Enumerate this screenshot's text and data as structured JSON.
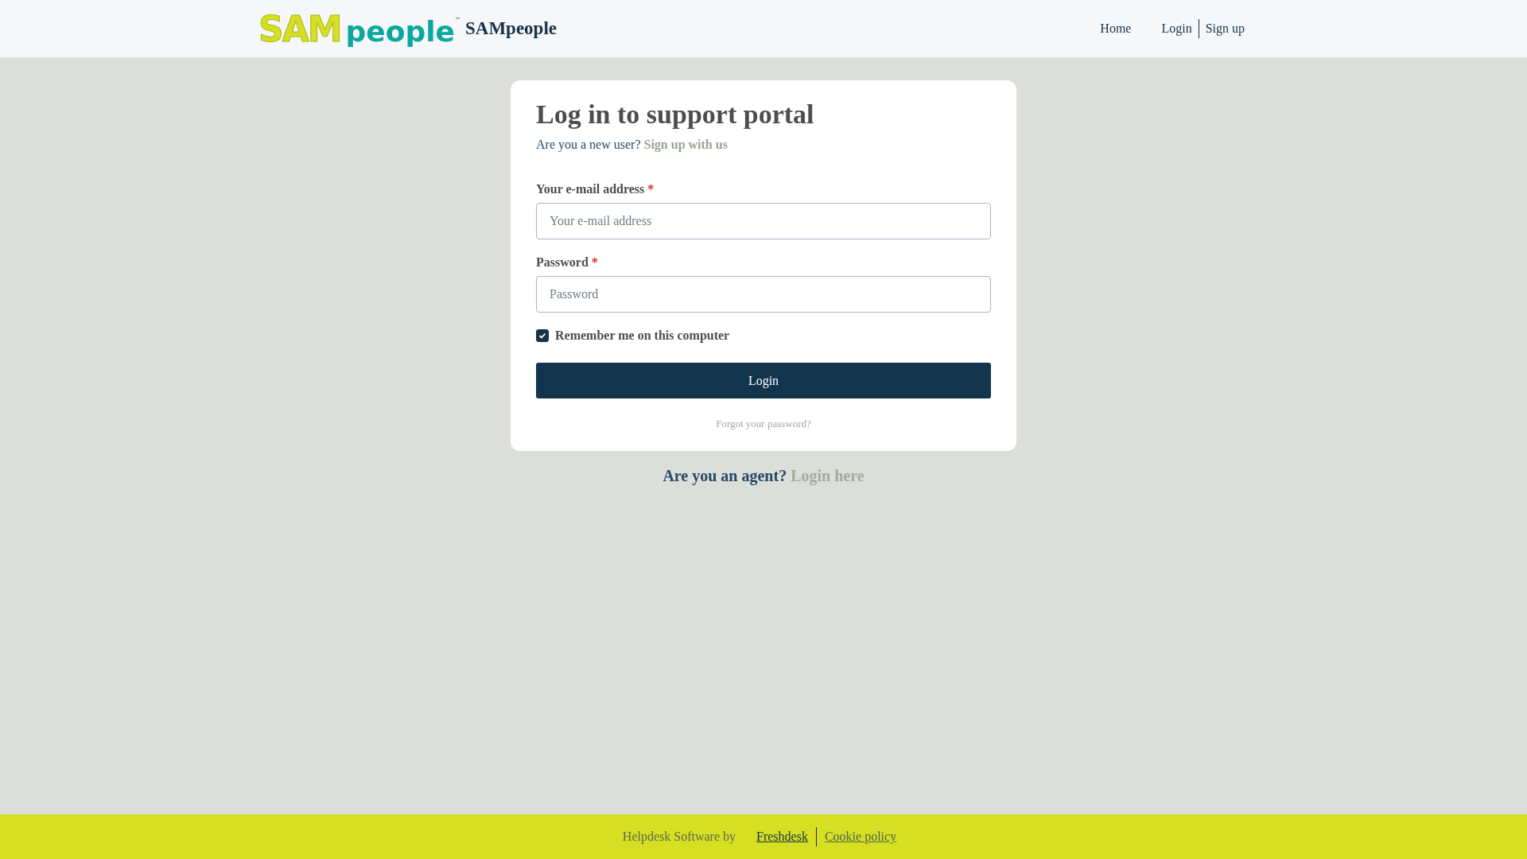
{
  "header": {
    "logo": {
      "part_1": "SAM",
      "part_2": "people",
      "trademark": "™"
    },
    "brand": "SAMpeople",
    "nav": [
      {
        "label": "Home"
      },
      {
        "label": "Login"
      },
      {
        "label": "Sign up"
      }
    ]
  },
  "card": {
    "title": "Log in to support portal",
    "subtitle": "Are you a new user?",
    "signup_link": "Sign up with us",
    "fields": [
      {
        "label": "Your e-mail address",
        "required": true,
        "required_mark": "*",
        "placeholder": "Your e-mail address"
      },
      {
        "label": "Password",
        "required": true,
        "required_mark": "*",
        "placeholder": "Password"
      }
    ],
    "remember": {
      "label": "Remember me on this computer",
      "checked": true
    },
    "button": "Login",
    "forgot": "Forgot your password?"
  },
  "agent": {
    "question": "Are you an agent?",
    "link": "Login here"
  },
  "footer": {
    "text": "Helpdesk Software by",
    "links": [
      "Freshdesk",
      "Cookie policy"
    ]
  }
}
